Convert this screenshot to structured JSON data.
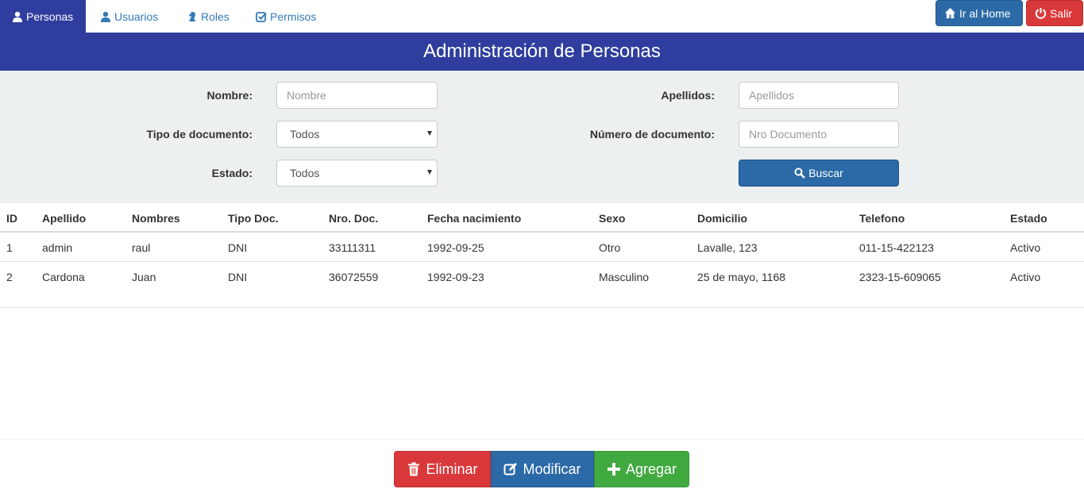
{
  "nav": {
    "tabs": [
      {
        "label": "Personas",
        "icon": "user-icon",
        "active": true
      },
      {
        "label": "Usuarios",
        "icon": "user-icon",
        "active": false
      },
      {
        "label": "Roles",
        "icon": "chess-knight-icon",
        "active": false
      },
      {
        "label": "Permisos",
        "icon": "check-square-icon",
        "active": false
      }
    ],
    "home_label": "Ir al Home",
    "salir_label": "Salir"
  },
  "page": {
    "title": "Administración de Personas"
  },
  "filters": {
    "nombre_label": "Nombre:",
    "nombre_placeholder": "Nombre",
    "apellidos_label": "Apellidos:",
    "apellidos_placeholder": "Apellidos",
    "tipo_doc_label": "Tipo de documento:",
    "tipo_doc_value": "Todos",
    "nro_doc_label": "Número de documento:",
    "nro_doc_placeholder": "Nro Documento",
    "estado_label": "Estado:",
    "estado_value": "Todos",
    "buscar_label": "Buscar"
  },
  "table": {
    "headers": [
      "ID",
      "Apellido",
      "Nombres",
      "Tipo Doc.",
      "Nro. Doc.",
      "Fecha nacimiento",
      "Sexo",
      "Domicilio",
      "Telefono",
      "Estado"
    ],
    "rows": [
      [
        "1",
        "admin",
        "raul",
        "DNI",
        "33111311",
        "1992-09-25",
        "Otro",
        "Lavalle, 123",
        "011-15-422123",
        "Activo"
      ],
      [
        "2",
        "Cardona",
        "Juan",
        "DNI",
        "36072559",
        "1992-09-23",
        "Masculino",
        "25 de mayo, 1168",
        "2323-15-609065",
        "Activo"
      ]
    ]
  },
  "actions": {
    "eliminar_label": "Eliminar",
    "modificar_label": "Modificar",
    "agregar_label": "Agregar"
  },
  "colors": {
    "brand": "#2f3e9e",
    "primary": "#2b6aa6",
    "danger": "#d9383a",
    "success": "#40a940",
    "panel": "#ecf0f1"
  }
}
